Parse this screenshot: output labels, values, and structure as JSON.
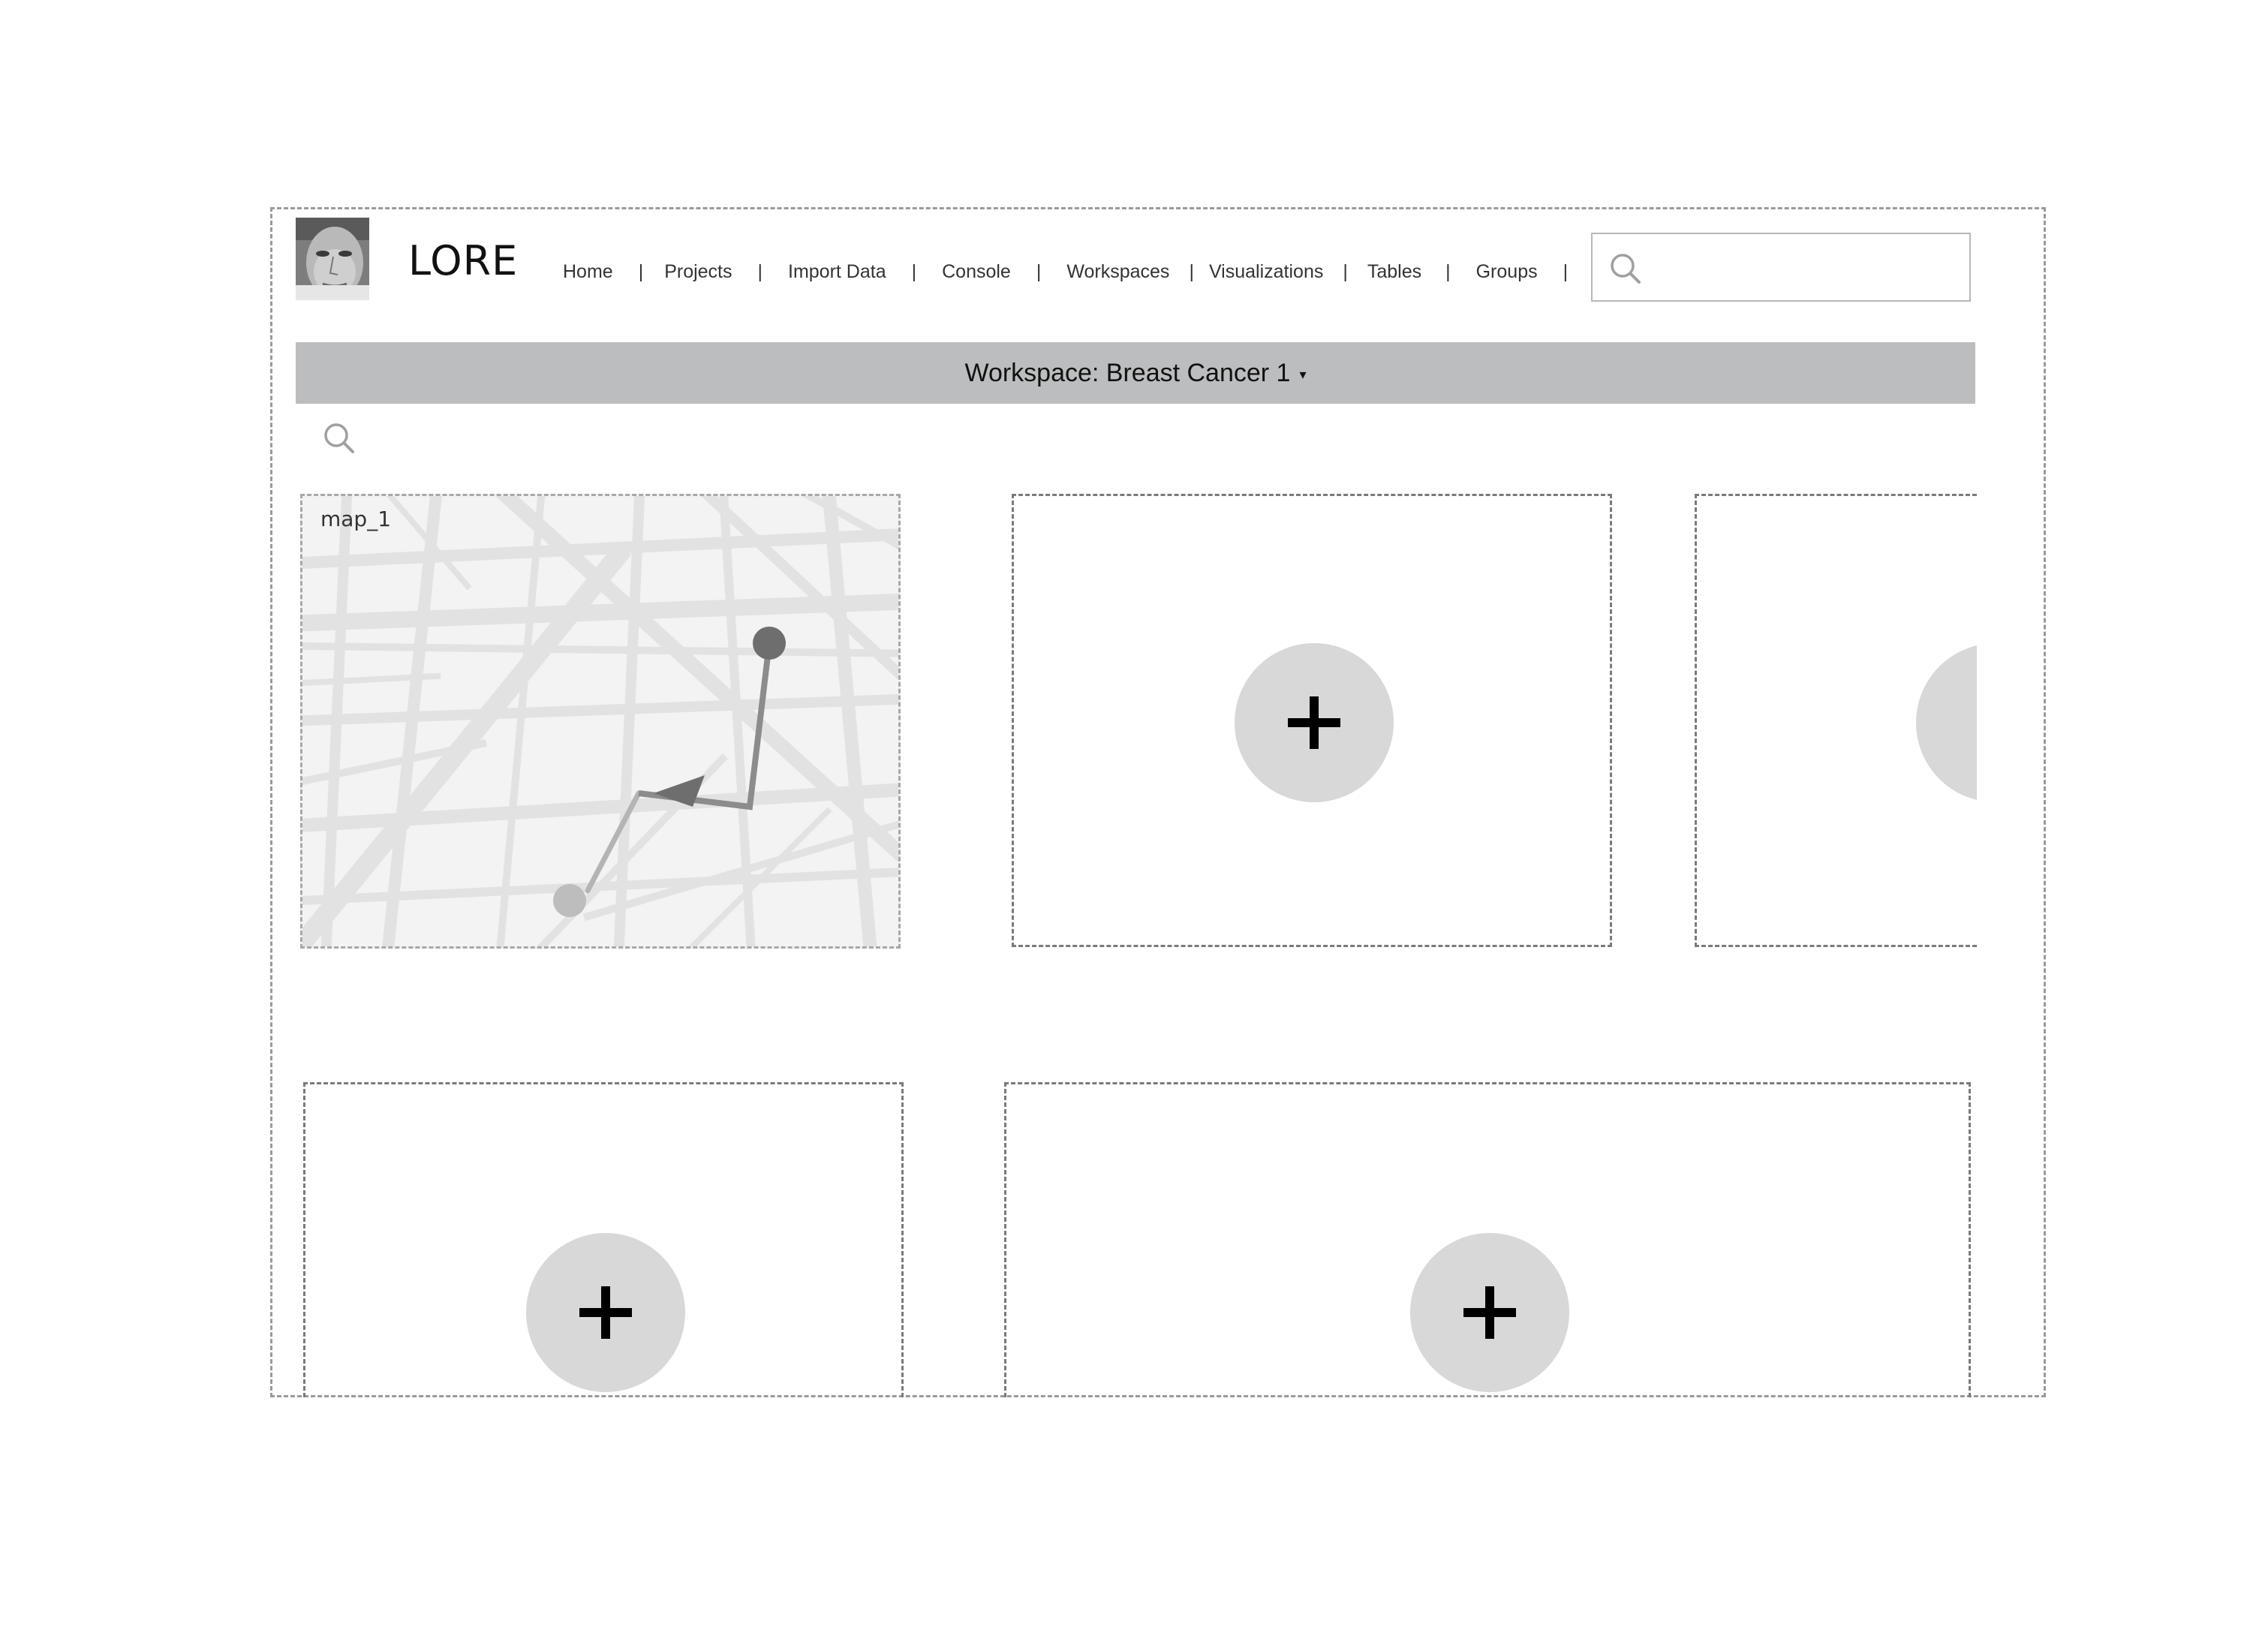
{
  "app": {
    "name": "LORE"
  },
  "nav": {
    "items": [
      {
        "label": "Home"
      },
      {
        "label": "Projects"
      },
      {
        "label": "Import Data"
      },
      {
        "label": "Console"
      },
      {
        "label": "Workspaces"
      },
      {
        "label": "Visualizations"
      },
      {
        "label": "Tables"
      },
      {
        "label": "Groups"
      }
    ],
    "separator": "|"
  },
  "search": {
    "placeholder": "",
    "value": ""
  },
  "workspace": {
    "label": "Workspace: Breast Cancer 1",
    "caret": "▾"
  },
  "panels": [
    {
      "title": "map_1",
      "type": "map"
    },
    {
      "title": "",
      "type": "empty"
    },
    {
      "title": "",
      "type": "empty"
    },
    {
      "title": "",
      "type": "empty"
    },
    {
      "title": "",
      "type": "empty"
    }
  ],
  "icons": {
    "search": "search-icon",
    "add": "plus-icon",
    "avatar": "user-avatar-photo"
  },
  "colors": {
    "workspace_bar": "#bcbdbe",
    "add_button": "#d8d8d8",
    "route_line": "#8c8c8c",
    "route_start": "#6e6e6e",
    "route_end": "#bdbdbd"
  }
}
